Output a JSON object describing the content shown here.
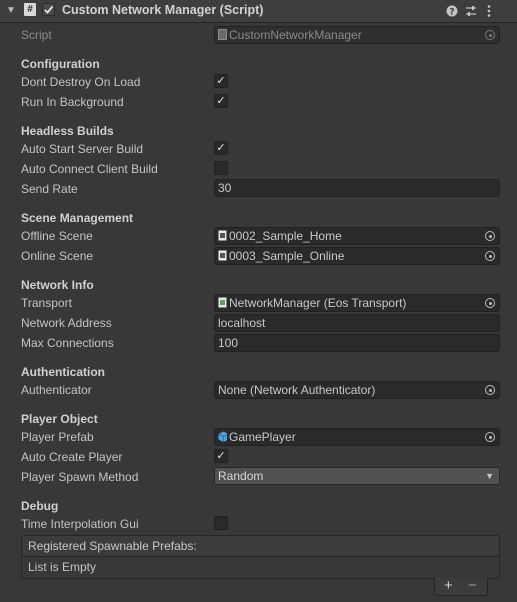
{
  "header": {
    "title": "Custom Network Manager (Script)",
    "fold_icon": "triangle-down-icon",
    "script_icon": "script-hash-icon",
    "enabled": true,
    "icons": [
      "help-icon",
      "preset-sliders-icon",
      "kebab-menu-icon"
    ]
  },
  "script": {
    "label": "Script",
    "value": "CustomNetworkManager"
  },
  "sections": {
    "configuration": "Configuration",
    "headless": "Headless Builds",
    "scene": "Scene Management",
    "network": "Network Info",
    "auth": "Authentication",
    "player": "Player Object",
    "debug": "Debug"
  },
  "fields": {
    "dont_destroy": {
      "label": "Dont Destroy On Load",
      "checked": true
    },
    "run_background": {
      "label": "Run In Background",
      "checked": true
    },
    "auto_start_server": {
      "label": "Auto Start Server Build",
      "checked": true
    },
    "auto_connect_client": {
      "label": "Auto Connect Client Build",
      "checked": false
    },
    "send_rate": {
      "label": "Send Rate",
      "value": "30"
    },
    "offline_scene": {
      "label": "Offline Scene",
      "value": "0002_Sample_Home"
    },
    "online_scene": {
      "label": "Online Scene",
      "value": "0003_Sample_Online"
    },
    "transport": {
      "label": "Transport",
      "value": "NetworkManager (Eos Transport)"
    },
    "network_address": {
      "label": "Network Address",
      "value": "localhost"
    },
    "max_connections": {
      "label": "Max Connections",
      "value": "100"
    },
    "authenticator": {
      "label": "Authenticator",
      "value": "None (Network Authenticator)"
    },
    "player_prefab": {
      "label": "Player Prefab",
      "value": "GamePlayer"
    },
    "auto_create_player": {
      "label": "Auto Create Player",
      "checked": true
    },
    "player_spawn_method": {
      "label": "Player Spawn Method",
      "value": "Random"
    },
    "time_interp_gui": {
      "label": "Time Interpolation Gui",
      "checked": false
    }
  },
  "spawnable_list": {
    "header": "Registered Spawnable Prefabs:",
    "empty_text": "List is Empty",
    "add_label": "+",
    "remove_label": "−"
  },
  "colors": {
    "background": "#383838",
    "field_bg": "#2a2a2a",
    "text": "#c4c4c4",
    "prefab_icon": "#4aa3df",
    "scene_icon": "#e8e8e8",
    "component_icon": "#5fa05f"
  }
}
